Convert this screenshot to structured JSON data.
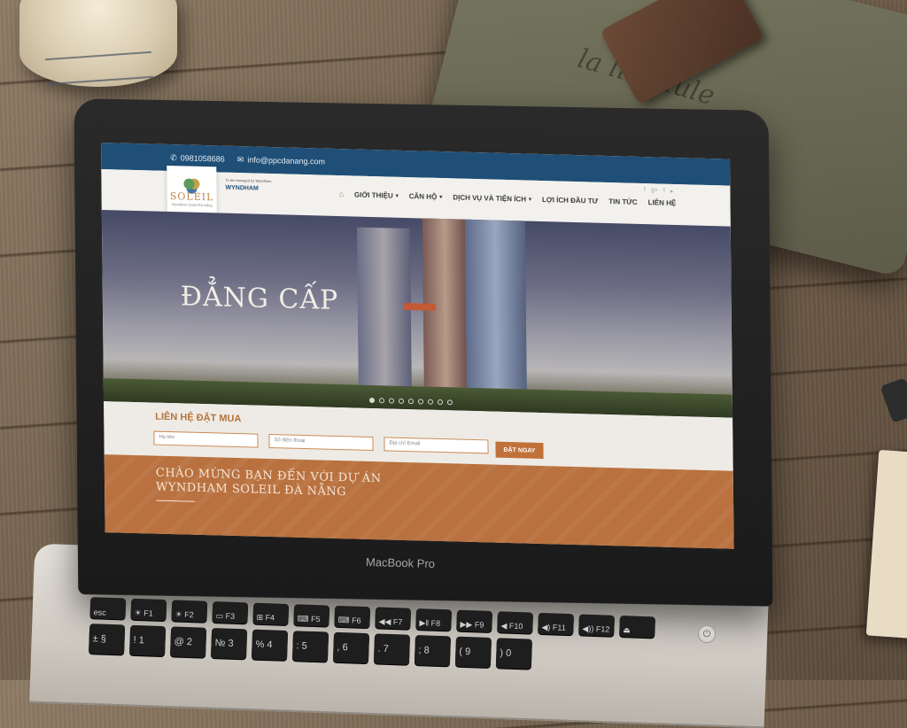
{
  "props": {
    "bag_text": "la libellule"
  },
  "laptop": {
    "brand": "MacBook Pro",
    "power_glyph": "⏻",
    "keyboard_rows": [
      [
        "esc",
        "☀ F1",
        "☀ F2",
        "▭ F3",
        "⊞ F4",
        "⌨ F5",
        "⌨ F6",
        "◀◀ F7",
        "▶‖ F8",
        "▶▶ F9",
        "◀ F10",
        "◀) F11",
        "◀)) F12",
        "⏏"
      ],
      [
        "± §",
        "! 1",
        "@ 2",
        "№ 3",
        "% 4",
        ": 5",
        ", 6",
        ". 7",
        "; 8",
        "( 9",
        ") 0"
      ]
    ]
  },
  "site": {
    "topbar": {
      "phone": "0981058686",
      "email": "info@ppcdanang.com",
      "phone_icon": "phone-icon",
      "email_icon": "envelope-icon"
    },
    "logo": {
      "name": "SOLEIL",
      "sub": "Wyndham Soleil Đà Nẵng",
      "managed_by": "To be managed by Wyndham",
      "partner": "WYNDHAM"
    },
    "nav": {
      "home_icon": "home-icon",
      "items": [
        {
          "label": "GIỚI THIỆU",
          "caret": "▾"
        },
        {
          "label": "CĂN HỘ",
          "caret": "▾"
        },
        {
          "label": "DỊCH VỤ VÀ TIỆN ÍCH",
          "caret": "▾"
        },
        {
          "label": "LỢI ÍCH ĐẦU TƯ",
          "caret": ""
        },
        {
          "label": "TIN TỨC",
          "caret": ""
        },
        {
          "label": "LIÊN HỆ",
          "caret": ""
        }
      ],
      "socials": [
        "f",
        "g+",
        "t",
        "▸"
      ]
    },
    "hero": {
      "title": "ĐẲNG CẤP",
      "slides": 9,
      "active_slide": 1
    },
    "contact": {
      "title": "LIÊN HỆ ĐẶT MUA",
      "name_placeholder": "Họ tên",
      "phone_placeholder": "Số điện thoại",
      "email_placeholder": "Địa chỉ Email",
      "submit_label": "ĐẶT NGAY"
    },
    "welcome": {
      "line1": "CHÀO MỪNG BẠN ĐẾN VỚI DỰ ÁN",
      "line2": "WYNDHAM SOLEIL ĐÀ NẴNG"
    },
    "colors": {
      "topbar": "#1f4f77",
      "accent": "#c0713a",
      "welcome_bg": "#b9713f"
    }
  }
}
